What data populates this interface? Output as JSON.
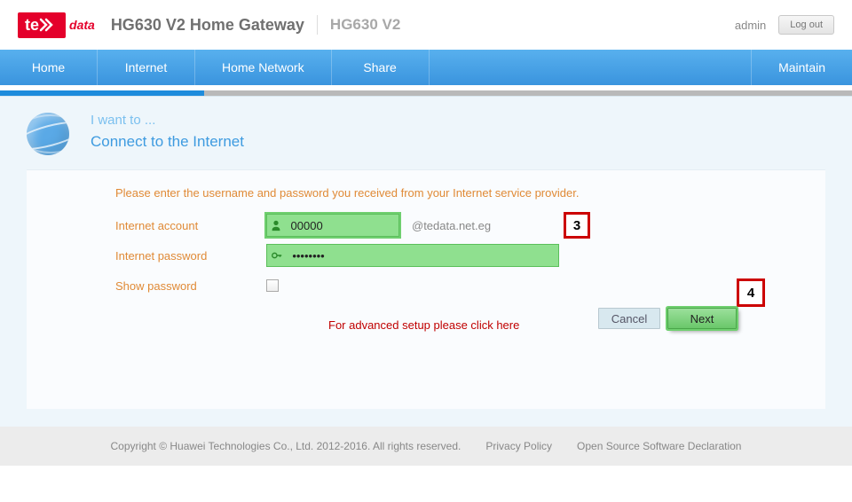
{
  "header": {
    "brand_prefix": "te",
    "brand_suffix": "data",
    "title_main": "HG630 V2 Home Gateway",
    "title_sub": "HG630 V2",
    "user": "admin",
    "logout": "Log out"
  },
  "nav": {
    "items": [
      "Home",
      "Internet",
      "Home Network",
      "Share"
    ],
    "maintain": "Maintain"
  },
  "panel": {
    "sup": "I want to ...",
    "title": "Connect to the Internet"
  },
  "form": {
    "instruction": "Please enter the username and password you received from your Internet service provider.",
    "account_label": "Internet account",
    "account_value": "00000",
    "account_suffix": "@tedata.net.eg",
    "password_label": "Internet password",
    "password_value": "••••••••",
    "show_pwd_label": "Show password",
    "advanced_link": "For advanced setup please click here"
  },
  "callouts": {
    "c3": "3",
    "c4": "4"
  },
  "buttons": {
    "cancel": "Cancel",
    "next": "Next"
  },
  "footer": {
    "copyright": "Copyright © Huawei Technologies Co., Ltd. 2012-2016. All rights reserved.",
    "privacy": "Privacy Policy",
    "oss": "Open Source Software Declaration"
  }
}
